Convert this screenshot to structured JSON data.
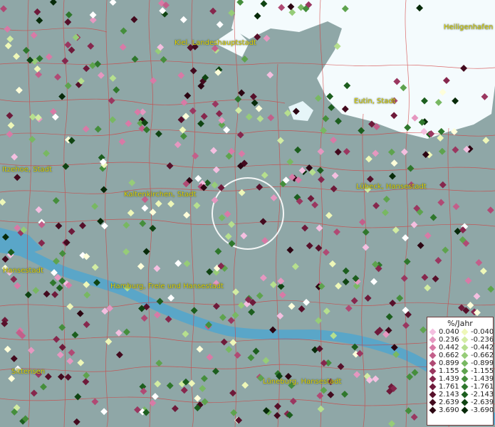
{
  "map": {
    "places": [
      {
        "name": "Kiel, Landeshauptstadt"
      },
      {
        "name": "Heiligenhafen"
      },
      {
        "name": "Eutin, Stadt"
      },
      {
        "name": "Itzehoe, Stadt"
      },
      {
        "name": "Kaltenkirchen, Stadt"
      },
      {
        "name": "Lübeck, Hansestadt"
      },
      {
        "name": "Hansestadt"
      },
      {
        "name": "Hamburg, Freie und Hansestadt"
      },
      {
        "name": "Sittensen"
      },
      {
        "name": "Lüneburg, Hansestadt"
      }
    ],
    "colors": {
      "land": "#8fa7a7",
      "water": "#5aa6c8",
      "sea": "#f4fbfd",
      "borders": "#d23b3b",
      "labels": "#e6d200"
    }
  },
  "legend": {
    "title": "%/Jahr",
    "positive": [
      {
        "label": "0.040",
        "color": "#f4bfe0"
      },
      {
        "label": "0.236",
        "color": "#e597c0"
      },
      {
        "label": "0.442",
        "color": "#d87aa6"
      },
      {
        "label": "0.662",
        "color": "#c35f8a"
      },
      {
        "label": "0.899",
        "color": "#b04a74"
      },
      {
        "label": "1.155",
        "color": "#9a3760"
      },
      {
        "label": "1.439",
        "color": "#86274d"
      },
      {
        "label": "1.761",
        "color": "#6e1a3a"
      },
      {
        "label": "2.143",
        "color": "#57102a"
      },
      {
        "label": "2.639",
        "color": "#430a1e"
      },
      {
        "label": "3.690",
        "color": "#2c0512"
      }
    ],
    "negative": [
      {
        "label": "-0.040",
        "color": "#eef7b8"
      },
      {
        "label": "-0.236",
        "color": "#d2eca2"
      },
      {
        "label": "-0.442",
        "color": "#b6df8e"
      },
      {
        "label": "-0.662",
        "color": "#96cc78"
      },
      {
        "label": "-0.899",
        "color": "#78b862"
      },
      {
        "label": "-1.155",
        "color": "#5ea34e"
      },
      {
        "label": "-1.439",
        "color": "#458e3c"
      },
      {
        "label": "-1.761",
        "color": "#2f772c"
      },
      {
        "label": "-2.143",
        "color": "#1c5e1e"
      },
      {
        "label": "-2.639",
        "color": "#0f4412"
      },
      {
        "label": "-3.690",
        "color": "#072a09"
      }
    ]
  }
}
